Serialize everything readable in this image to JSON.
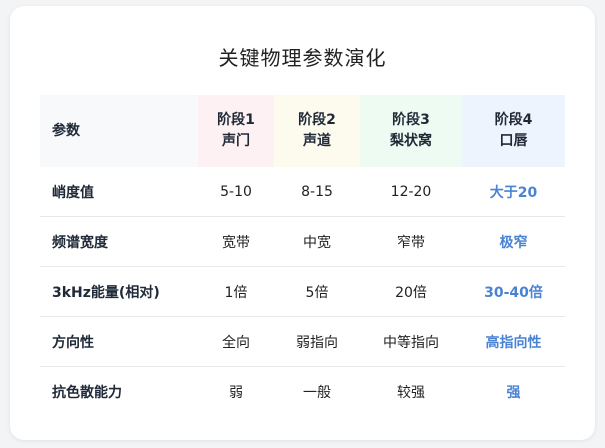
{
  "title": "关键物理参数演化",
  "header": {
    "param": "参数",
    "stages": [
      {
        "line1": "阶段1",
        "line2": "声门"
      },
      {
        "line1": "阶段2",
        "line2": "声道"
      },
      {
        "line1": "阶段3",
        "line2": "梨状窝"
      },
      {
        "line1": "阶段4",
        "line2": "口唇"
      }
    ]
  },
  "rows": [
    {
      "label": "峭度值",
      "values": [
        "5-10",
        "8-15",
        "12-20",
        "大于20"
      ]
    },
    {
      "label": "频谱宽度",
      "values": [
        "宽带",
        "中宽",
        "窄带",
        "极窄"
      ]
    },
    {
      "label": "3kHz能量(相对)",
      "values": [
        "1倍",
        "5倍",
        "20倍",
        "30-40倍"
      ]
    },
    {
      "label": "方向性",
      "values": [
        "全向",
        "弱指向",
        "中等指向",
        "高指向性"
      ]
    },
    {
      "label": "抗色散能力",
      "values": [
        "弱",
        "一般",
        "较强",
        "强"
      ]
    }
  ],
  "colors": {
    "highlight": "#4a83d4",
    "stage1_bg": "#fdf1f3",
    "stage2_bg": "#fdfaee",
    "stage3_bg": "#eefbf2",
    "stage4_bg": "#eef4fd"
  }
}
